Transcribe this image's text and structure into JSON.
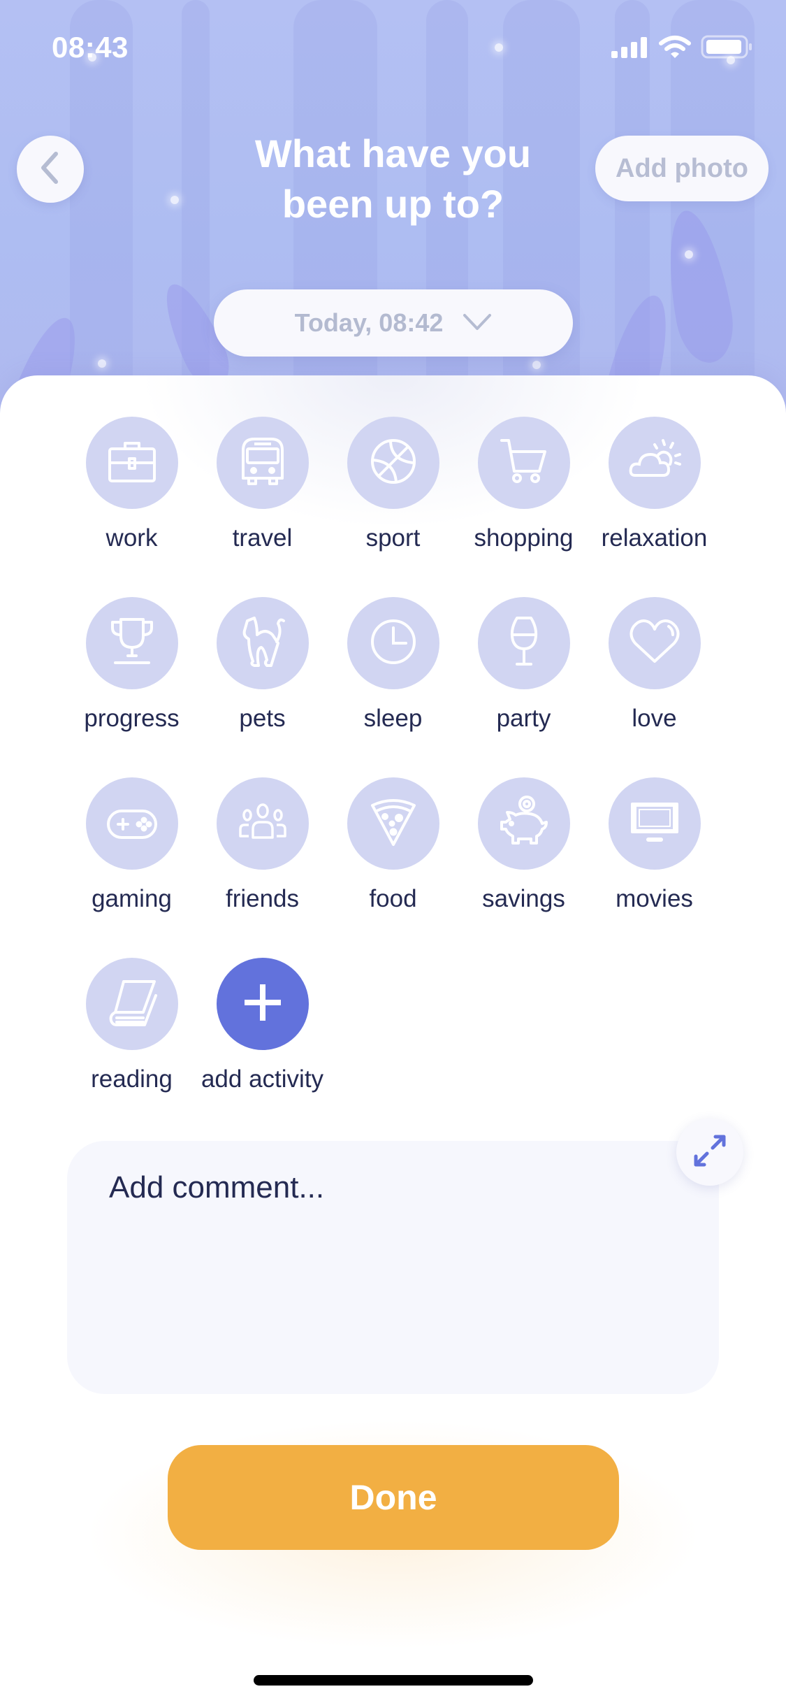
{
  "status_bar": {
    "time": "08:43",
    "icons": [
      "signal-icon",
      "wifi-icon",
      "battery-icon"
    ]
  },
  "header": {
    "back_icon": "chevron-left-icon",
    "title_line1": "What have you",
    "title_line2": "been up to?",
    "add_photo_label": "Add photo"
  },
  "date_selector": {
    "value": "Today, 08:42",
    "icon": "chevron-down-icon"
  },
  "activities": [
    {
      "label": "work",
      "icon": "briefcase-icon"
    },
    {
      "label": "travel",
      "icon": "bus-icon"
    },
    {
      "label": "sport",
      "icon": "basketball-icon"
    },
    {
      "label": "shopping",
      "icon": "cart-icon"
    },
    {
      "label": "relaxation",
      "icon": "sun-cloud-icon"
    },
    {
      "label": "progress",
      "icon": "trophy-icon"
    },
    {
      "label": "pets",
      "icon": "cat-icon"
    },
    {
      "label": "sleep",
      "icon": "clock-icon"
    },
    {
      "label": "party",
      "icon": "wine-glass-icon"
    },
    {
      "label": "love",
      "icon": "heart-icon"
    },
    {
      "label": "gaming",
      "icon": "gamepad-icon"
    },
    {
      "label": "friends",
      "icon": "people-icon"
    },
    {
      "label": "food",
      "icon": "pizza-icon"
    },
    {
      "label": "savings",
      "icon": "piggy-bank-icon"
    },
    {
      "label": "movies",
      "icon": "tv-icon"
    },
    {
      "label": "reading",
      "icon": "book-icon"
    },
    {
      "label": "add activity",
      "icon": "plus-icon"
    }
  ],
  "comment": {
    "placeholder": "Add comment...",
    "expand_icon": "expand-icon"
  },
  "done_label": "Done",
  "colors": {
    "accent": "#6272dc",
    "icon_circle": "#d1d5f2",
    "done": "#f2af43",
    "text_dark": "#242a52",
    "muted": "#b7bdd3"
  }
}
